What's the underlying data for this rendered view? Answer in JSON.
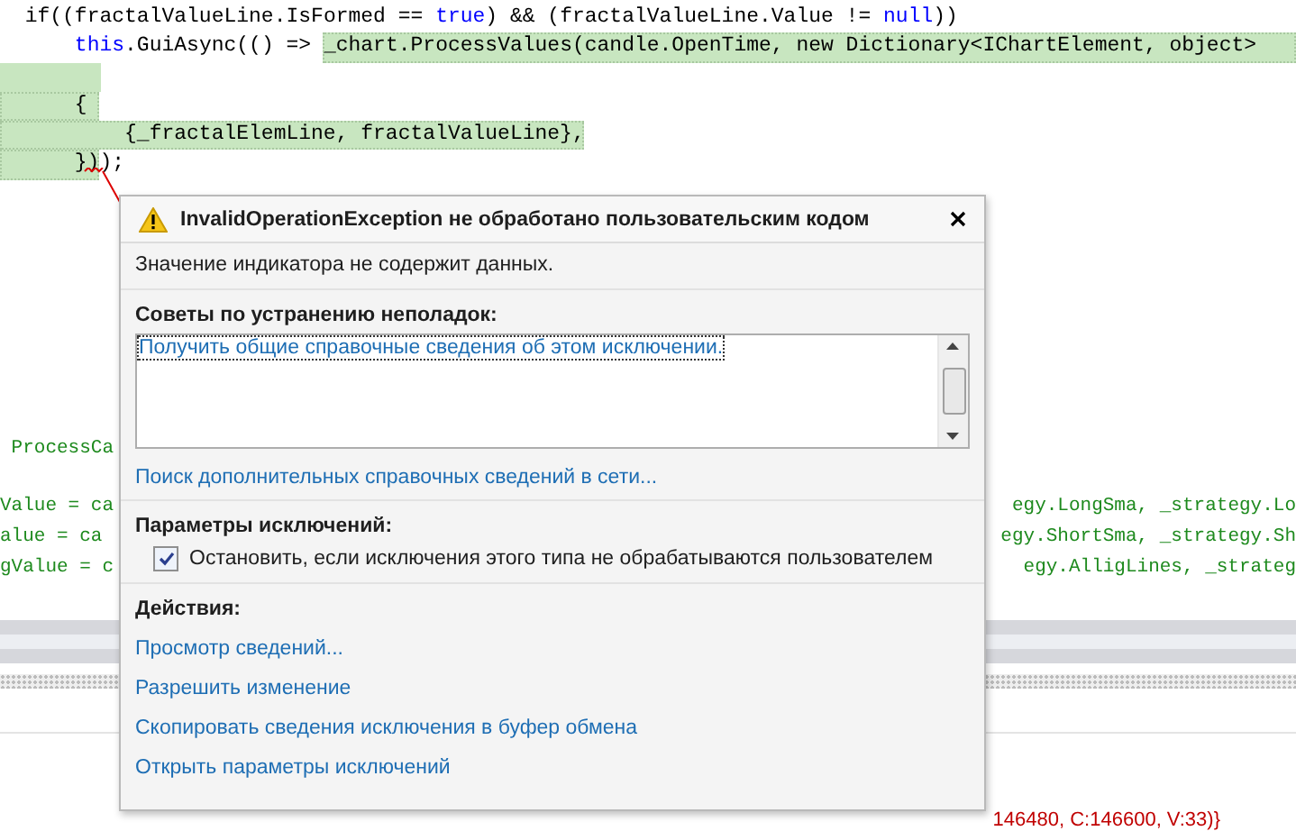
{
  "editor": {
    "lines": [
      {
        "kind": "code",
        "segments": [
          {
            "text": "  if((fractalValueLine.IsFormed == ",
            "kind": "plain",
            "highlighted": false
          },
          {
            "text": "true",
            "kind": "keyword",
            "highlighted": false
          },
          {
            "text": ") && (fractalValueLine.Value != ",
            "kind": "plain",
            "highlighted": false
          },
          {
            "text": "null",
            "kind": "keyword",
            "highlighted": false
          },
          {
            "text": "))",
            "kind": "plain",
            "highlighted": false
          }
        ]
      },
      {
        "kind": "code",
        "segments": [
          {
            "text": "      this",
            "kind": "keyword",
            "highlighted": false
          },
          {
            "text": ".GuiAsync(() => ",
            "kind": "plain",
            "highlighted": false
          },
          {
            "text": "_chart.ProcessValues(candle.OpenTime, new Dictionary<IChartElement, object>",
            "kind": "plain",
            "highlighted": true
          }
        ]
      },
      {
        "kind": "highlighted-blank"
      },
      {
        "kind": "code",
        "segments": [
          {
            "text": "      { ",
            "kind": "plain",
            "highlighted": true
          }
        ]
      },
      {
        "kind": "code",
        "segments": [
          {
            "text": "          {_fractalElemLine, fractalValueLine},",
            "kind": "plain",
            "highlighted": true
          }
        ]
      },
      {
        "kind": "code",
        "segments": [
          {
            "text": "      })",
            "kind": "plain",
            "highlighted": true
          },
          {
            "text": ");",
            "kind": "plain",
            "highlighted": false
          }
        ]
      }
    ],
    "method_line": " ProcessCa",
    "lower_lines": [
      {
        "left": "Value = ca",
        "right": "egy.LongSma, _strategy.Lo"
      },
      {
        "left": "alue = ca",
        "right": "egy.ShortSma, _strategy.Sh"
      },
      {
        "left": "gValue = c",
        "right": "egy.AlligLines, _strateg"
      }
    ]
  },
  "output": {
    "text": "146480, C:146600, V:33)}"
  },
  "exception_dialog": {
    "title": "InvalidOperationException не обработано пользовательским кодом",
    "message": "Значение индикатора не содержит данных.",
    "troubleshooting": {
      "heading": "Советы по устранению неполадок:",
      "items": [
        {
          "label": "Получить общие справочные сведения об этом исключении.",
          "selected": true
        }
      ],
      "search_link": "Поиск дополнительных справочных сведений в сети..."
    },
    "settings": {
      "heading": "Параметры исключений:",
      "checkbox": {
        "label": "Остановить, если исключения этого типа не обрабатываются пользователем",
        "checked": true
      }
    },
    "actions": {
      "heading": "Действия:",
      "links": [
        "Просмотр сведений...",
        "Разрешить изменение",
        "Скопировать сведения исключения в буфер обмена",
        "Открыть параметры исключений"
      ]
    }
  }
}
